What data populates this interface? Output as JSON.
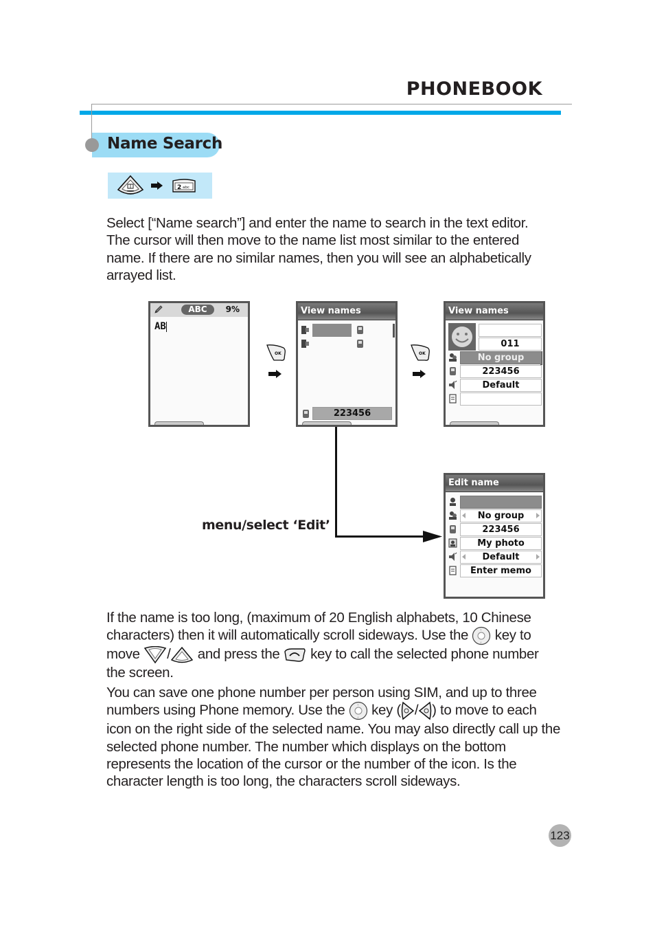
{
  "header": {
    "title": "PHONEBOOK"
  },
  "section": {
    "title": "Name Search",
    "key_sequence": [
      {
        "icon": "menu-key-icon"
      },
      {
        "icon": "arrow-right-icon"
      },
      {
        "icon": "key-2-abc-icon",
        "label": "2",
        "sub": "abc"
      }
    ]
  },
  "intro_paragraph": "Select [“Name search”] and enter the name to search in the text editor. The cursor will then move to the name list most similar to the entered name. If there are no similar names, then you will see an alphabetically arrayed list.",
  "screens": {
    "editor": {
      "mode_badge": "ABC",
      "capacity": "9%",
      "input_text": "AB"
    },
    "view_names_list": {
      "title": "View names",
      "bottom_number": "223456"
    },
    "view_names_detail": {
      "title": "View names",
      "fields": [
        "",
        "011",
        "No group",
        "223456",
        "Default",
        ""
      ]
    },
    "edit_name": {
      "title": "Edit name",
      "fields": [
        "",
        "No group",
        "223456",
        "My photo",
        "Default",
        "Enter memo"
      ]
    }
  },
  "flow": {
    "ok_key_label": "OK",
    "menu_label": "menu/select ‘Edit’"
  },
  "paragraph2": {
    "part1": "If the name is too long, (maximum of 20 English alphabets, 10 Chinese characters) then it will automatically scroll sideways. Use the ",
    "part2": " key to move ",
    "part3": "/",
    "part4": " and press the ",
    "part5": " key to call the selected phone number the screen."
  },
  "paragraph3": {
    "part1": "You can save one phone number per person using SIM, and up to three numbers using Phone memory. Use the ",
    "part2": " key (",
    "part3": "/",
    "part4": ") to move to each icon on the right side of the selected name. You may also directly call up the selected phone number. The number which displays on the bottom represents the location of the cursor or the number of the icon. Is the character length is too long, the characters scroll sideways."
  },
  "page_number": "123",
  "colors": {
    "accent_blue": "#00a8e8",
    "pill_blue": "#9cdcf5",
    "strip_blue": "#c2e8f9",
    "grey": "#999999"
  }
}
